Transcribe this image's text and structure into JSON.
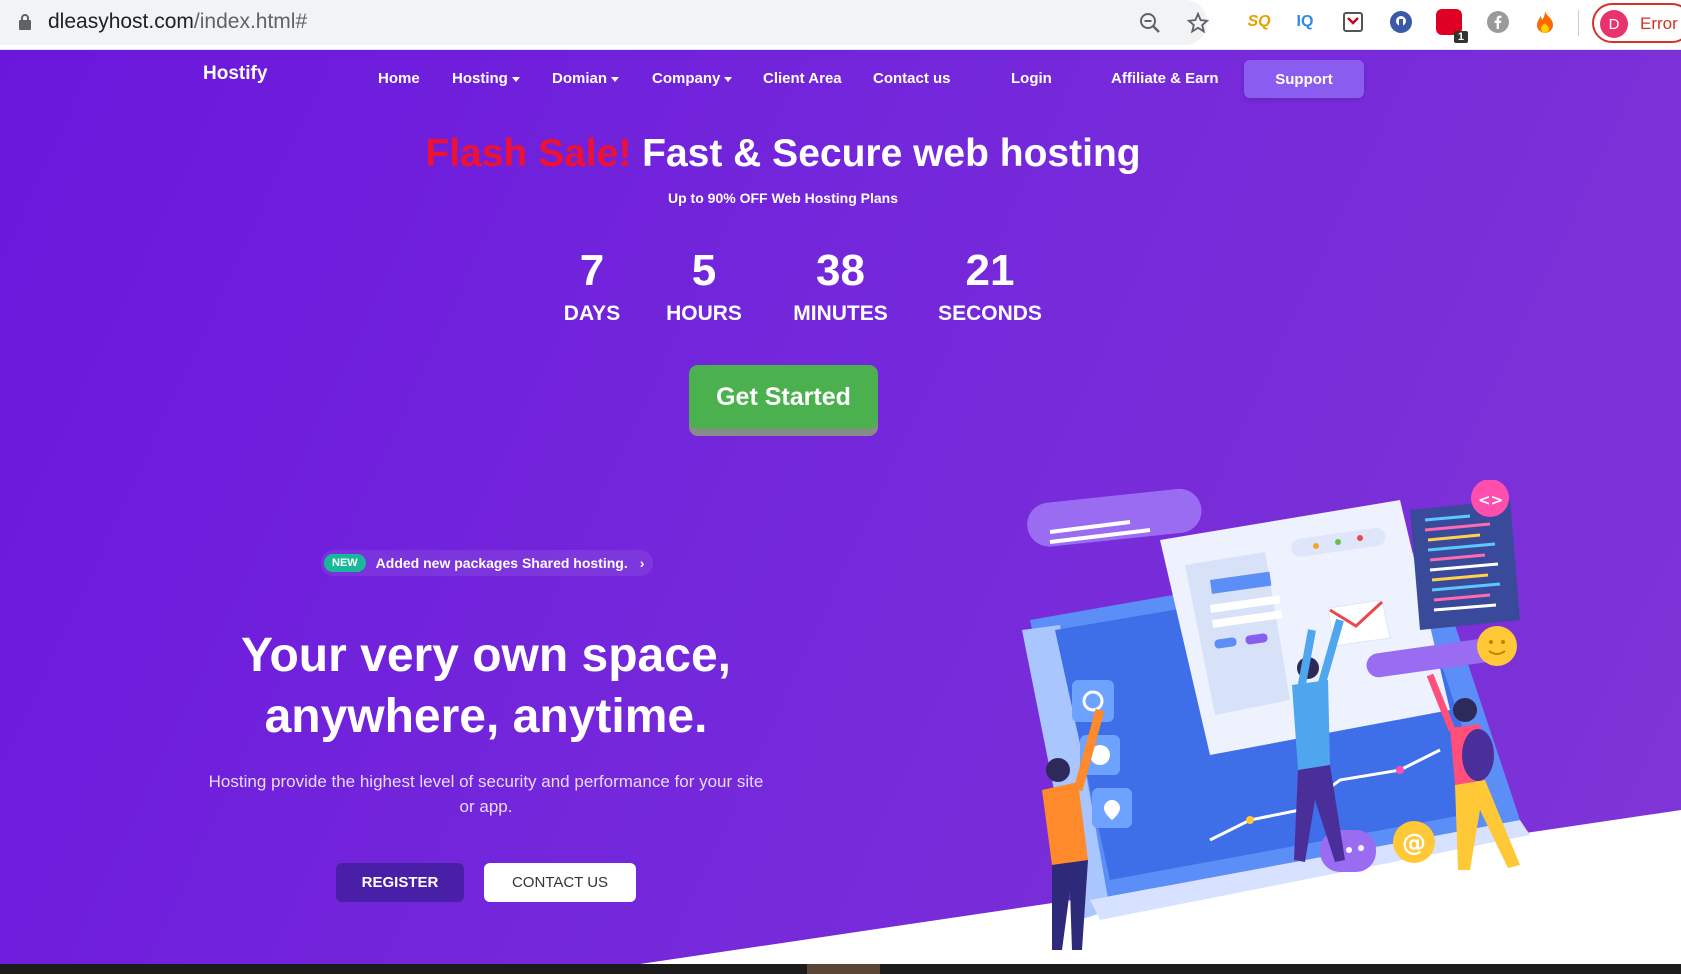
{
  "browser": {
    "url_host": "dleasyhost.com",
    "url_path": "/index.html#",
    "profile_initial": "D",
    "profile_status": "Error",
    "extensions": [
      {
        "name": "sq-extension-icon",
        "text": "SQ",
        "color": "#f5a623"
      },
      {
        "name": "iq-extension-icon",
        "text": "IQ",
        "color": "#2e8ae6"
      },
      {
        "name": "pocket-extension-icon",
        "text": "",
        "color": "#d0021b"
      },
      {
        "name": "shield-extension-icon",
        "text": "",
        "color": "#3a5aa8"
      },
      {
        "name": "badge-extension-icon",
        "text": "1",
        "color": "#e00024"
      },
      {
        "name": "facebook-extension-icon",
        "text": "",
        "color": "#999"
      },
      {
        "name": "fire-extension-icon",
        "text": "",
        "color": "#ff6a00"
      }
    ]
  },
  "nav": {
    "brand": "Hostify",
    "items": [
      "Home",
      "Hosting",
      "Domian",
      "Company",
      "Client Area",
      "Contact us",
      "Login",
      "Affiliate & Earn"
    ],
    "support": "Support"
  },
  "hero": {
    "flash": "Flash Sale!",
    "headline": "Fast & Secure web hosting",
    "subheadline": "Up to 90% OFF Web Hosting Plans",
    "countdown": [
      {
        "value": "7",
        "unit": "DAYS"
      },
      {
        "value": "5",
        "unit": "HOURS"
      },
      {
        "value": "38",
        "unit": "MINUTES"
      },
      {
        "value": "21",
        "unit": "SECONDS"
      }
    ],
    "cta": "Get Started"
  },
  "announcement": {
    "badge": "NEW",
    "text": "Added new packages Shared hosting."
  },
  "intro": {
    "title_line1": "Your very own space,",
    "title_line2": "anywhere, anytime.",
    "description": "Hosting provide the highest level of security and performance for your site or app.",
    "register": "REGISTER",
    "contact": "CONTACT US"
  },
  "colors": {
    "hero_bg": "#7427db",
    "flash": "#ee1133",
    "cta": "#4bb14f",
    "support": "#8b5cf0",
    "register": "#4a1fa8",
    "new_badge": "#1ab89a"
  }
}
